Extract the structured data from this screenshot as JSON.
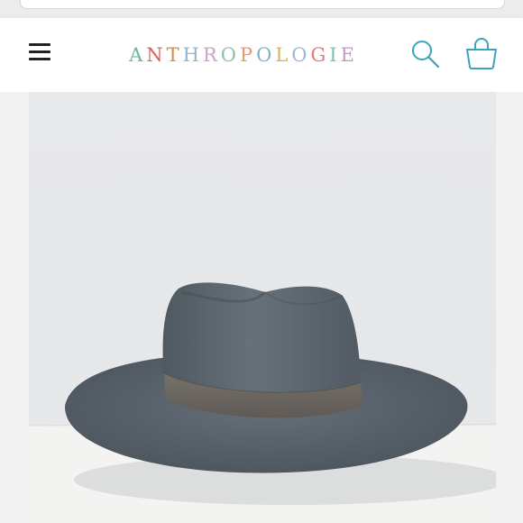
{
  "brand": {
    "letters": [
      "A",
      "N",
      "T",
      "H",
      "R",
      "O",
      "P",
      "O",
      "L",
      "O",
      "G",
      "I",
      "E"
    ],
    "letter_colors": [
      "#6fb79a",
      "#d9645d",
      "#e08a3c",
      "#8cb7cf",
      "#c9a4c8",
      "#8fc0a8",
      "#e19a70",
      "#7db3c9",
      "#d8b25a",
      "#9ab8d6",
      "#e07d7a",
      "#7cc0b4",
      "#c29ac6"
    ]
  },
  "header": {
    "menu_icon": "hamburger-menu-icon",
    "search_icon": "search-icon",
    "bag_icon": "shopping-bag-icon",
    "icon_color": "#3aa3bf"
  },
  "product": {
    "image": "gray-wool-fedora-hat-with-suede-band"
  }
}
